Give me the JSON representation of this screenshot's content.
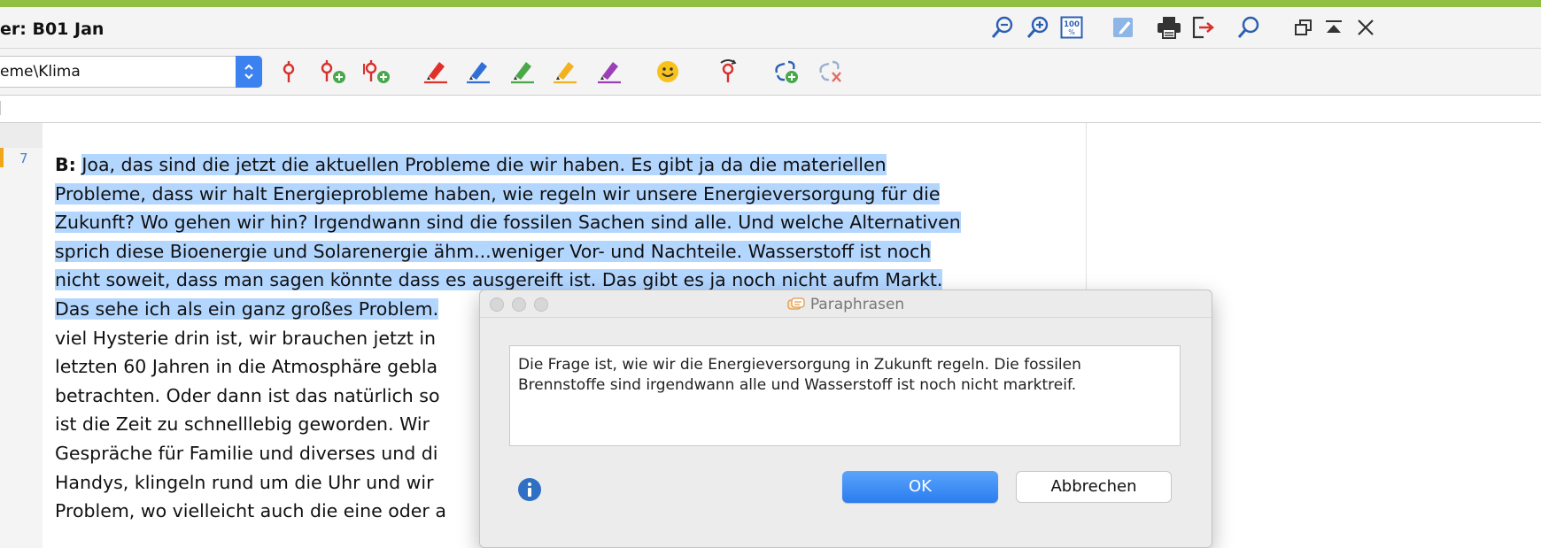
{
  "window": {
    "title": "er: B01 Jan",
    "accent_color": "#8fc043",
    "title_icons": [
      "zoom-out-icon",
      "zoom-in-icon",
      "zoom-100-icon",
      "edit-icon",
      "print-icon",
      "export-icon",
      "search-icon",
      "restore-window-icon",
      "minimize-up-icon",
      "close-icon"
    ]
  },
  "toolbar": {
    "code_selector_value": "eme\\Klima",
    "tools": [
      "code-icon",
      "add-code-icon",
      "add-in-vivo-code-icon",
      "red-highlighter-icon",
      "blue-highlighter-icon",
      "green-highlighter-icon",
      "yellow-highlighter-icon",
      "purple-highlighter-icon",
      "emoticon-icon",
      "code-favorite-icon",
      "add-link-icon",
      "remove-link-icon"
    ]
  },
  "document": {
    "paragraph_number": "7",
    "speaker": "B:",
    "lines": [
      {
        "text": "Joa, das sind die jetzt die aktuellen Probleme die wir haben. Es gibt ja da die materiellen",
        "highlighted": true
      },
      {
        "text": "Probleme, dass wir halt Energieprobleme haben, wie regeln wir unsere Energieversorgung für die",
        "highlighted": true
      },
      {
        "text": "Zukunft? Wo gehen wir hin? Irgendwann sind die fossilen Sachen sind alle. Und welche Alternativen",
        "highlighted": true
      },
      {
        "text": "sprich diese Bioenergie und Solarenergie ähm...weniger Vor- und Nachteile. Wasserstoff ist noch",
        "highlighted": true
      },
      {
        "text": "nicht soweit, dass man sagen könnte dass es ausgereift ist. Das gibt es ja noch nicht aufm Markt.",
        "highlighted": true
      },
      {
        "text": "Das sehe ich als ein ganz großes Problem.",
        "highlighted": true
      },
      {
        "text": "viel Hysterie drin ist, wir brauchen jetzt in",
        "highlighted": false
      },
      {
        "text": "letzten 60 Jahren in die Atmosphäre gebla",
        "highlighted": false
      },
      {
        "text": "betrachten. Oder dann ist das natürlich so",
        "highlighted": false
      },
      {
        "text": "ist die Zeit zu schnelllebig geworden. Wir",
        "highlighted": false
      },
      {
        "text": "Gespräche für Familie und diverses und di",
        "highlighted": false
      },
      {
        "text": "Handys, klingeln rund um die Uhr und wir",
        "highlighted": false
      },
      {
        "text": "Problem, wo vielleicht auch die eine oder a",
        "highlighted": false
      }
    ],
    "highlight_color": "#b3d6ff"
  },
  "dialog": {
    "title": "Paraphrasen",
    "paraphrase_text": "Die Frage ist, wie wir die Energieversorgung in Zukunft regeln. Die fossilen Brennstoffe sind irgendwann alle und Wasserstoff ist noch nicht marktreif.",
    "ok_label": "OK",
    "cancel_label": "Abbrechen"
  }
}
